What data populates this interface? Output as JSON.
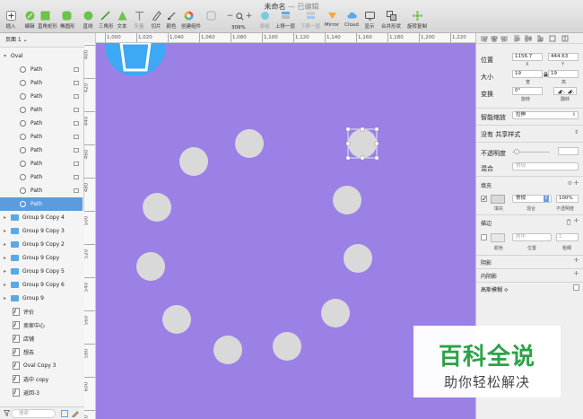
{
  "window": {
    "title": "未命名",
    "subtitle": "— 已编辑"
  },
  "toolbar": {
    "tools": [
      "插入",
      "编辑",
      "直角矩形",
      "椭圆形",
      "直线",
      "三角形",
      "文本",
      "矢量",
      "切片",
      "颜色",
      "创建组件",
      "",
      "上移一层",
      "下移一层",
      "Mirror",
      "Cloud",
      "显示",
      "合并形状",
      "旋转复制"
    ],
    "zoom": "309%",
    "zoom_minus": "−",
    "zoom_plus": "+",
    "group_label": "表组"
  },
  "layers_panel": {
    "page": "页面 1 ⌄",
    "items": [
      {
        "name": "Oval",
        "kind": "group-open"
      },
      {
        "name": "Path",
        "kind": "oval"
      },
      {
        "name": "Path",
        "kind": "oval"
      },
      {
        "name": "Path",
        "kind": "oval"
      },
      {
        "name": "Path",
        "kind": "oval"
      },
      {
        "name": "Path",
        "kind": "oval"
      },
      {
        "name": "Path",
        "kind": "oval"
      },
      {
        "name": "Path",
        "kind": "oval"
      },
      {
        "name": "Path",
        "kind": "oval"
      },
      {
        "name": "Path",
        "kind": "oval"
      },
      {
        "name": "Path",
        "kind": "oval"
      },
      {
        "name": "Path",
        "kind": "oval-selected"
      },
      {
        "name": "Group 9 Copy 4",
        "kind": "folder"
      },
      {
        "name": "Group 9 Copy 3",
        "kind": "folder"
      },
      {
        "name": "Group 9 Copy 2",
        "kind": "folder"
      },
      {
        "name": "Group 9 Copy",
        "kind": "folder"
      },
      {
        "name": "Group 9 Copy 5",
        "kind": "folder"
      },
      {
        "name": "Group 9 Copy 6",
        "kind": "folder"
      },
      {
        "name": "Group 9",
        "kind": "folder"
      },
      {
        "name": "评价",
        "kind": "art"
      },
      {
        "name": "卖家中心",
        "kind": "art"
      },
      {
        "name": "店铺",
        "kind": "art"
      },
      {
        "name": "想去",
        "kind": "art"
      },
      {
        "name": "Oval Copy 3",
        "kind": "art"
      },
      {
        "name": "选中 copy",
        "kind": "art"
      },
      {
        "name": "返回-3",
        "kind": "art"
      }
    ],
    "filter_placeholder": "搜索"
  },
  "rulers": {
    "h_labels": [
      "1,000",
      "1,020",
      "1,040",
      "1,060",
      "1,080",
      "1,100",
      "1,120",
      "1,140",
      "1,160",
      "1,180",
      "1,200",
      "1,220"
    ],
    "v_labels": [
      "400",
      "420",
      "440",
      "460",
      "480",
      "500",
      "520",
      "540",
      "560",
      "580",
      "600",
      "620"
    ]
  },
  "canvas": {
    "background": "#9b80e6",
    "dot_color": "#d9d9d9",
    "icon_color": "#3da8f5"
  },
  "inspector": {
    "position_label": "位置",
    "x_value": "1156.7",
    "y_value": "444.63",
    "x_cap": "X",
    "y_cap": "Y",
    "size_label": "大小",
    "w_value": "19",
    "h_value": "19",
    "w_cap": "宽",
    "h_cap": "高",
    "transform_label": "变换",
    "rotate_value": "0°",
    "rotate_cap": "旋转",
    "flip_cap": "翻转",
    "resize_label": "智能缩放",
    "resize_value": "拉伸",
    "shared_style": "没有 共享样式",
    "opacity_label": "不透明度",
    "blend_label": "混合",
    "blend_value": "常规",
    "fill_label": "填充",
    "fill_blend": "常规",
    "fill_opacity": "100%",
    "fill_cap": "填充",
    "fill_blend_cap": "混合",
    "fill_opacity_cap": "不透明度",
    "border_label": "描边",
    "border_position": "居中",
    "border_width": "1",
    "border_color_cap": "颜色",
    "border_pos_cap": "位置",
    "border_width_cap": "粗细",
    "shadow_label": "阴影",
    "inner_shadow_label": "内阴影",
    "blur_label": "高斯模糊 ≎"
  },
  "watermark": {
    "title": "百科全说",
    "subtitle": "助你轻松解决"
  }
}
